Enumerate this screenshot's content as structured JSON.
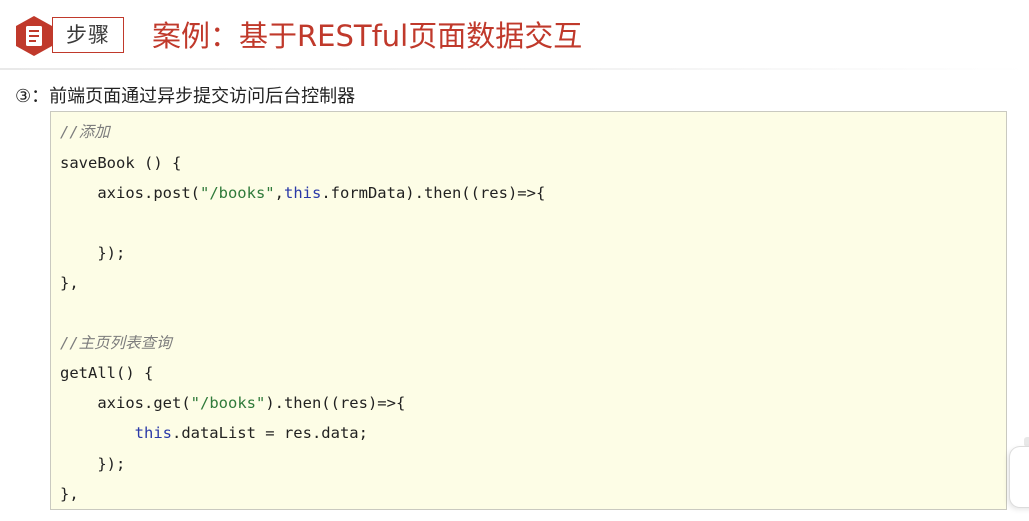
{
  "header": {
    "badge_icon": "document-icon",
    "step_label": "步骤",
    "title": "案例：基于RESTful页面数据交互",
    "accent_color": "#c0392b"
  },
  "subtitle": "③：前端页面通过异步提交访问后台控制器",
  "code": {
    "comment_add": "//添加",
    "save_sig": "saveBook () {",
    "post_prefix": "    axios.post(",
    "post_str": "\"/books\"",
    "post_comma": ",",
    "post_this": "this",
    "post_suffix": ".formData).then((res)=>{",
    "close1": "    });",
    "close_save": "},",
    "comment_list": "//主页列表查询",
    "getall_sig": "getAll() {",
    "get_prefix": "    axios.get(",
    "get_str": "\"/books\"",
    "get_suffix": ").then((res)=>{",
    "assign_indent": "        ",
    "assign_this": "this",
    "assign_rest": ".dataList = res.data;",
    "close2": "    });",
    "close_getall": "},"
  }
}
